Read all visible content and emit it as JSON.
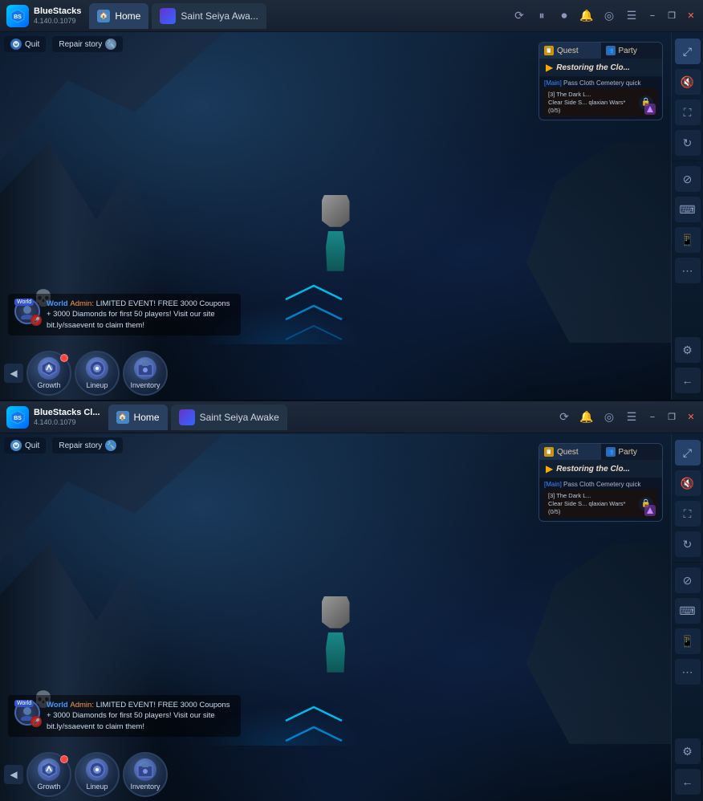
{
  "window1": {
    "title": "BlueStacks",
    "version": "4.140.0.1079",
    "tabs": [
      {
        "id": "home",
        "label": "Home",
        "active": true
      },
      {
        "id": "game",
        "label": "Saint Seiya Awa...",
        "active": false
      }
    ],
    "controls": {
      "sync": "⟳",
      "pause": "⏸",
      "record": "⏺",
      "bell": "🔔",
      "settings2": "◎",
      "menu": "☰",
      "minimize": "−",
      "restore": "❐",
      "close": "✕"
    }
  },
  "window2": {
    "title": "BlueStacks Cl...",
    "version": "4.140.0.1079",
    "tabs": [
      {
        "id": "home2",
        "label": "Home",
        "active": true
      },
      {
        "id": "game2",
        "label": "Saint Seiya Awake",
        "active": false
      }
    ]
  },
  "toolbar": {
    "quit_label": "Quit",
    "repair_label": "Repair story"
  },
  "quest": {
    "tab_quest": "Quest",
    "tab_party": "Party",
    "quest_title": "Restoring the Clo...",
    "quest_main": "[Main]",
    "quest_pass": "Pass Cloth Cemetery quick",
    "quest_sub_title": "[3] The Dark L...",
    "quest_sub_desc": "Clear Side S...   qlaxian Wars* (0/5)",
    "quest_lock": "🔒"
  },
  "chat": {
    "world_badge": "World",
    "admin_prefix": "Admin:",
    "message": "LIMITED EVENT! FREE 3000 Coupons + 3000 Diamonds for first 50 players! Visit our site bit.ly/ssaevent to claim them!"
  },
  "action_bar": {
    "growth_label": "Growth",
    "lineup_label": "Lineup",
    "inventory_label": "Inventory"
  },
  "right_panel": {
    "buttons": [
      {
        "id": "expand",
        "icon": "⤢",
        "label": "expand"
      },
      {
        "id": "sound",
        "icon": "🔇",
        "label": "sound"
      },
      {
        "id": "fullscreen",
        "icon": "⛶",
        "label": "fullscreen"
      },
      {
        "id": "rotate",
        "icon": "⟳",
        "label": "rotate"
      },
      {
        "id": "block",
        "icon": "⊘",
        "label": "block"
      },
      {
        "id": "keyboard",
        "icon": "⌨",
        "label": "keyboard"
      },
      {
        "id": "phone",
        "icon": "📱",
        "label": "phone"
      },
      {
        "id": "more",
        "icon": "⋯",
        "label": "more"
      },
      {
        "id": "gear",
        "icon": "⚙",
        "label": "gear"
      },
      {
        "id": "back",
        "icon": "←",
        "label": "back"
      }
    ]
  }
}
